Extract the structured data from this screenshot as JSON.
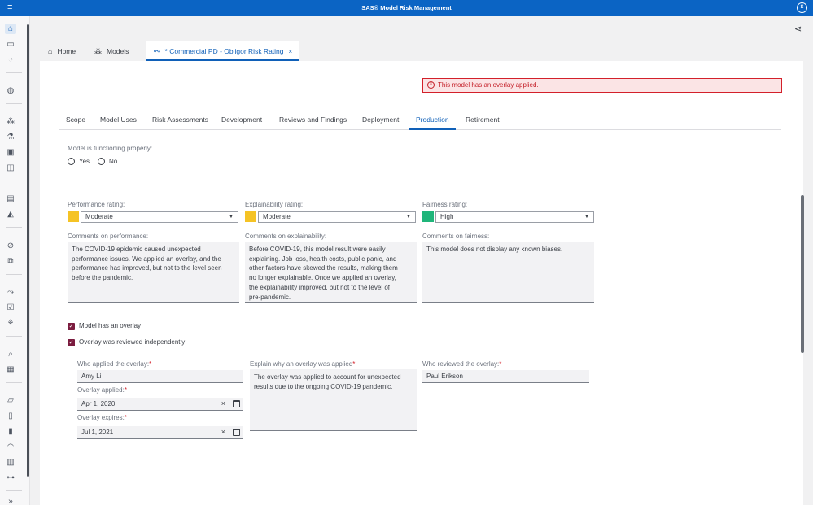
{
  "app": {
    "title": "SAS® Model Risk Management",
    "user_initial": "S"
  },
  "doc_tabs": [
    {
      "label": "Home",
      "icon": "home-icon"
    },
    {
      "label": "Models",
      "icon": "models-icon"
    },
    {
      "label": "* Commercial PD - Obligor Risk Rating",
      "icon": "model-tree-icon",
      "active": true
    }
  ],
  "alert": {
    "text": "This model has an overlay applied."
  },
  "section_tabs": [
    "Scope",
    "Model Uses",
    "Risk Assessments",
    "Development",
    "Reviews and Findings",
    "Deployment",
    "Production",
    "Retirement"
  ],
  "active_section_tab": "Production",
  "functioning": {
    "label": "Model is functioning properly:",
    "options": [
      "Yes",
      "No"
    ]
  },
  "ratings": {
    "performance": {
      "label": "Performance rating:",
      "value": "Moderate",
      "color": "#f5c325"
    },
    "explainability": {
      "label": "Explainability rating:",
      "value": "Moderate",
      "color": "#f5c325"
    },
    "fairness": {
      "label": "Fairness rating:",
      "value": "High",
      "color": "#1fb57a"
    }
  },
  "comments": {
    "performance": {
      "label": "Comments on performance:",
      "lines": [
        "The COVID-19 epidemic caused unexpected",
        "performance issues. We applied an overlay, and the",
        "performance has improved, but not to the level seen",
        "before the pandemic."
      ]
    },
    "explainability": {
      "label": "Comments on explainability:",
      "lines": [
        "Before COVID-19, this model result were easily",
        "explaining. Job loss, health costs, public panic, and",
        "other factors have skewed the results, making them",
        "no longer explainable. Once we applied an overlay,",
        "the explainability improved, but not to the level of",
        "pre-pandemic."
      ]
    },
    "fairness": {
      "label": "Comments on fairness:",
      "lines": [
        "This model does not display any known biases."
      ]
    }
  },
  "checks": {
    "has_overlay": "Model has an overlay",
    "reviewed_independently": "Overlay was reviewed independently"
  },
  "overlay": {
    "applied_by": {
      "label": "Who applied the overlay:",
      "value": "Amy Li"
    },
    "applied_on": {
      "label": "Overlay applied:",
      "value": "Apr 1, 2020"
    },
    "expires": {
      "label": "Overlay expires:",
      "value": "Jul 1, 2021"
    },
    "why": {
      "label": "Explain why an overlay was applied",
      "lines": [
        "The overlay was applied to account for unexpected",
        "results due to the ongoing COVID-19 pandemic."
      ]
    },
    "reviewed_by": {
      "label": "Who reviewed the overlay:",
      "value": "Paul Erikson"
    },
    "required_mark": "*"
  },
  "icons": {
    "menu": "≡",
    "share": "⋖",
    "clear": "×",
    "close": "×",
    "dropdown": "▼",
    "check": "✓"
  }
}
